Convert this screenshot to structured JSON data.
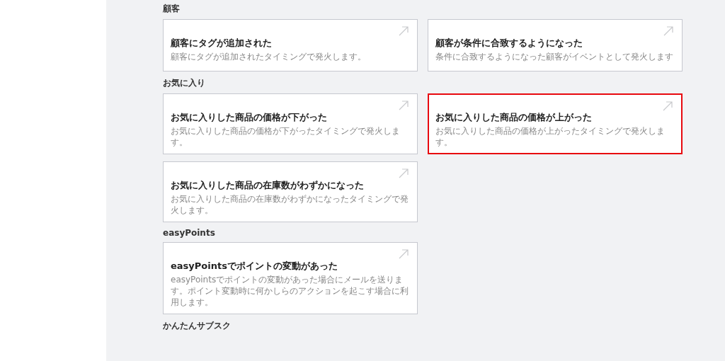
{
  "sections": [
    {
      "heading": "顧客",
      "cards": [
        {
          "title": "顧客にタグが追加された",
          "description": "顧客にタグが追加されたタイミングで発火します。",
          "highlighted": false
        },
        {
          "title": "顧客が条件に合致するようになった",
          "description": "条件に合致するようになった顧客がイベントとして発火します",
          "highlighted": false
        }
      ]
    },
    {
      "heading": "お気に入り",
      "cards": [
        {
          "title": "お気に入りした商品の価格が下がった",
          "description": "お気に入りした商品の価格が下がったタイミングで発火します。",
          "highlighted": false
        },
        {
          "title": "お気に入りした商品の価格が上がった",
          "description": "お気に入りした商品の価格が上がったタイミングで発火します。",
          "highlighted": true
        },
        {
          "title": "お気に入りした商品の在庫数がわずかになった",
          "description": "お気に入りした商品の在庫数がわずかになったタイミングで発火します。",
          "highlighted": false
        }
      ]
    },
    {
      "heading": "easyPoints",
      "cards": [
        {
          "title": "easyPointsでポイントの変動があった",
          "description": "easyPointsでポイントの変動があった場合にメールを送ります。ポイント変動時に何かしらのアクションを起こす場合に利用します。",
          "highlighted": false
        }
      ]
    },
    {
      "heading": "かんたんサブスク"
    }
  ]
}
